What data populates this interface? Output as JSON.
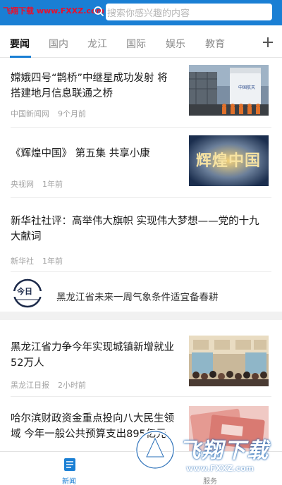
{
  "header": {
    "watermark_text": "飞翔下载 www.FXXZ.com",
    "search_placeholder": "搜索你感兴趣的内容",
    "accent_color": "#1a7fd4"
  },
  "tabs": [
    {
      "label": "要闻",
      "active": true
    },
    {
      "label": "国内",
      "active": false
    },
    {
      "label": "龙江",
      "active": false
    },
    {
      "label": "国际",
      "active": false
    },
    {
      "label": "娱乐",
      "active": false
    },
    {
      "label": "教育",
      "active": false
    }
  ],
  "articles": [
    {
      "title_line1": "嫦娥四号“鹊桥”中继星成功发射 将",
      "title_line2": "搭建地月信息联通之桥",
      "source": "中国新闻网",
      "time": "9个月前",
      "thumb": "rocket-launch-photo"
    },
    {
      "title_line1": "《辉煌中国》 第五集 共享小康",
      "title_line2": "",
      "source": "央视网",
      "time": "1年前",
      "thumb": "glorious-china-title-photo",
      "thumb_caption": "辉煌中国"
    },
    {
      "title_line1": "新华社社评：高举伟大旗帜 实现伟大梦想——党的十九",
      "title_line2": "大献词",
      "source": "新华社",
      "time": "1年前"
    },
    {
      "title_line1": "黑龙江省力争今年实现城镇新增就业",
      "title_line2": "52万人",
      "source": "黑龙江日报",
      "time": "2小时前",
      "thumb": "job-fair-crowd-photo"
    },
    {
      "title_line1": "哈尔滨财政资金重点投向八大民生领",
      "title_line2": "域 今年一般公共预算支出895亿元",
      "thumb": "banknotes-photo"
    }
  ],
  "weather": {
    "text": "黑龙江省未来一周气象条件适宜备春耕",
    "logo": "jinri-logo",
    "logo_text": "今日"
  },
  "bottom_nav": [
    {
      "label": "新闻",
      "active": true
    },
    {
      "label": "服务",
      "active": false
    }
  ],
  "watermark_br": {
    "main": "飞翔下载",
    "url": "www.FXXZ.com"
  }
}
